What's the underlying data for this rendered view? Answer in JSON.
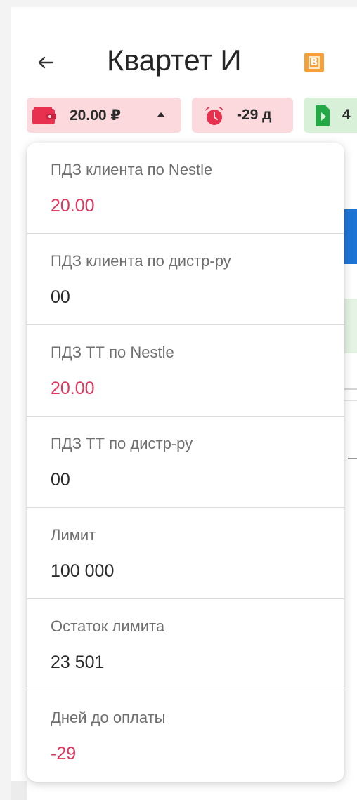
{
  "header": {
    "title": "Квартет И",
    "badge_letter": "B"
  },
  "chips": {
    "balance": {
      "value": "20.00 ₽",
      "icon": "wallet-icon",
      "color": "#e8304f"
    },
    "days": {
      "value": "-29 д",
      "icon": "alarm-clock-icon",
      "color": "#e8304f"
    },
    "doc": {
      "value": "4",
      "icon": "document-arrow-icon",
      "color": "#22a845"
    }
  },
  "debt_details": [
    {
      "label": "ПДЗ клиента по Nestle",
      "value": "20.00",
      "highlight": true
    },
    {
      "label": "ПДЗ клиента по дистр-ру",
      "value": "00",
      "highlight": false
    },
    {
      "label": "ПДЗ ТТ по Nestle",
      "value": "20.00",
      "highlight": true
    },
    {
      "label": "ПДЗ ТТ по дистр-ру",
      "value": "00",
      "highlight": false
    },
    {
      "label": "Лимит",
      "value": "100 000",
      "highlight": false
    },
    {
      "label": "Остаток лимита",
      "value": "23 501",
      "highlight": false
    },
    {
      "label": "Дней до оплаты",
      "value": "-29",
      "highlight": true
    }
  ],
  "colors": {
    "accent_red": "#e0355e",
    "chip_red_bg": "#fbd9dc",
    "chip_green_bg": "#d8f0d8",
    "badge_orange": "#f5a03a"
  }
}
